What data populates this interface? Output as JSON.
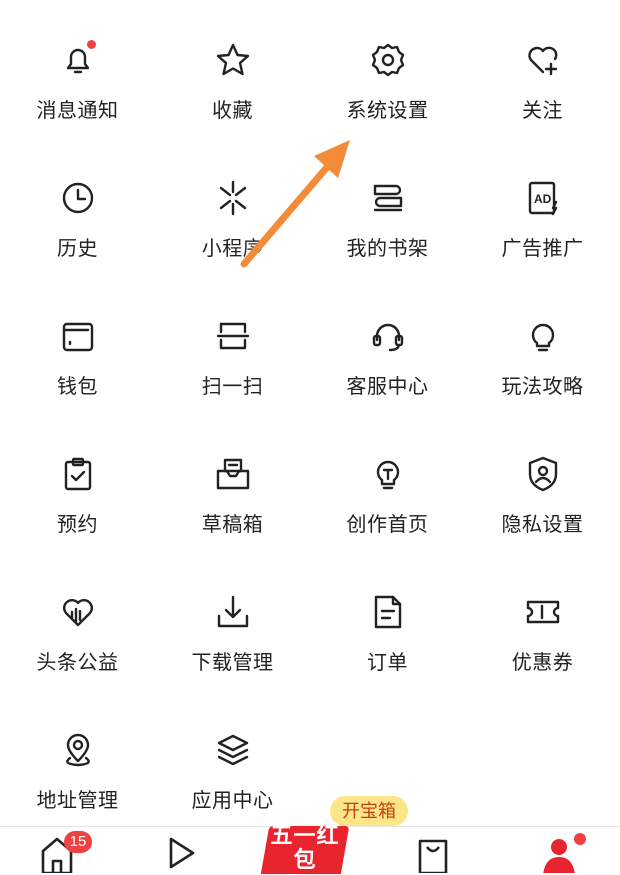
{
  "grid_items": [
    {
      "label": "消息通知",
      "icon": "bell-icon",
      "dot": true
    },
    {
      "label": "收藏",
      "icon": "star-icon"
    },
    {
      "label": "系统设置",
      "icon": "gear-icon"
    },
    {
      "label": "关注",
      "icon": "heart-plus-icon"
    },
    {
      "label": "历史",
      "icon": "clock-icon"
    },
    {
      "label": "小程序",
      "icon": "mini-program-icon"
    },
    {
      "label": "我的书架",
      "icon": "bookshelf-icon"
    },
    {
      "label": "广告推广",
      "icon": "ad-icon"
    },
    {
      "label": "钱包",
      "icon": "wallet-icon"
    },
    {
      "label": "扫一扫",
      "icon": "scan-icon"
    },
    {
      "label": "客服中心",
      "icon": "headset-icon"
    },
    {
      "label": "玩法攻略",
      "icon": "lightbulb-icon"
    },
    {
      "label": "预约",
      "icon": "clipboard-check-icon"
    },
    {
      "label": "草稿箱",
      "icon": "draft-box-icon"
    },
    {
      "label": "创作首页",
      "icon": "creator-bulb-icon"
    },
    {
      "label": "隐私设置",
      "icon": "shield-user-icon"
    },
    {
      "label": "头条公益",
      "icon": "charity-heart-icon"
    },
    {
      "label": "下载管理",
      "icon": "download-icon"
    },
    {
      "label": "订单",
      "icon": "order-doc-icon"
    },
    {
      "label": "优惠券",
      "icon": "coupon-icon"
    },
    {
      "label": "地址管理",
      "icon": "location-pin-icon"
    },
    {
      "label": "应用中心",
      "icon": "layers-icon"
    }
  ],
  "tabbar": {
    "home_badge": "15",
    "treasure_label": "开宝箱",
    "promo_text": "五一红包"
  },
  "colors": {
    "accent": "#f04142",
    "arrow": "#f28c38",
    "treasure_bg": "#fde68a"
  }
}
